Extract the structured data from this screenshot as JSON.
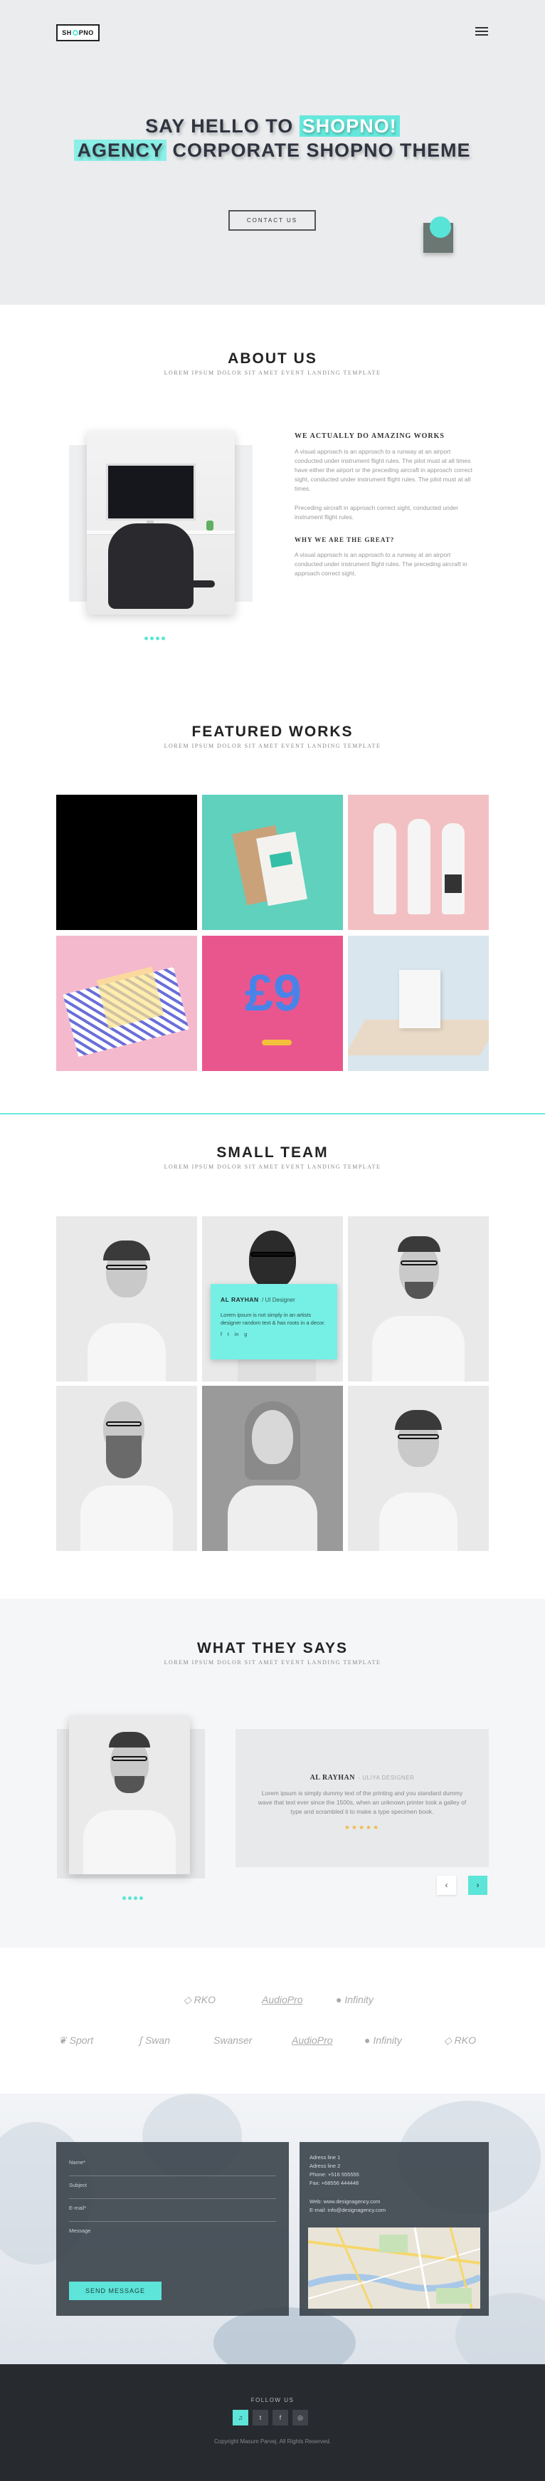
{
  "header": {
    "logo_left": "SH",
    "logo_right": "PNO",
    "menu_icon": "hamburger-icon"
  },
  "hero": {
    "line1_plain": "SAY HELLO TO",
    "line1_highlight": "SHOPNO!",
    "line2_highlight": "AGENCY",
    "line2_plain": "CORPORATE SHOPNO THEME",
    "button": "CONTACT US"
  },
  "about": {
    "title": "ABOUT US",
    "subtitle": "LOREM IPSUM DOLOR SIT AMET EVENT LANDING TEMPLATE",
    "heading1": "WE ACTUALLY DO AMAZING WORKS",
    "para1": "A visual approach is an approach to a runway at an airport conducted under instrument flight rules. The pilot must at all times have either the airport or the preceding aircraft in approach correct sight, conducted under instrument flight rules. The pilot must at all times.",
    "para2": "Preceding aircraft in approach correct sight, conducted under instrument flight rules.",
    "heading2": "WHY WE ARE THE GREAT?",
    "para3": "A visual approach is an approach to a runway at an airport conducted under instrument flight rules. The preceding aircraft in approach correct sight."
  },
  "works": {
    "title": "FEATURED WORKS",
    "subtitle": "LOREM IPSUM DOLOR SIT AMET EVENT LANDING TEMPLATE"
  },
  "team": {
    "title": "SMALL TEAM",
    "subtitle": "LOREM IPSUM DOLOR SIT AMET EVENT LANDING TEMPLATE",
    "card_name": "AL RAYHAN",
    "card_role": "/ UI Designer",
    "card_text": "Lorem ipsum is not simply in an artists designer random text & has roots in a decor.",
    "social": [
      "f",
      "t",
      "in",
      "g"
    ]
  },
  "testimonials": {
    "title": "WHAT THEY SAYS",
    "subtitle": "LOREM IPSUM DOLOR SIT AMET EVENT LANDING TEMPLATE",
    "name": "AL RAYHAN",
    "role": "- ULIYA DESIGNER",
    "quote": "Lorem ipsum is simply dummy text of the printing and you standard dummy wave that text ever since the 1500s, when an unknown printer took a galley of type and scrambled it to make a type specimen book.",
    "stars": "★★★★★",
    "prev": "‹",
    "next": "›"
  },
  "brands": {
    "row1": [
      "RKO",
      "AudioPro",
      "Infinity"
    ],
    "row2": [
      "Sport",
      "Swan",
      "Swanser",
      "AudioPro",
      "Infinity",
      "RKO"
    ]
  },
  "contact": {
    "fields": [
      "Name*",
      "Subject",
      "E-mail*",
      "Message"
    ],
    "send": "SEND MESSAGE",
    "info": [
      "Adress line 1",
      "Adress line 2",
      "Phone: +516 555555",
      "Fax: +68556 444448",
      "Web: www.designagency.com",
      "E-mail: info@designagency.com"
    ]
  },
  "footer": {
    "follow": "FOLLOW US",
    "icons": [
      "♫",
      "t",
      "f",
      "◎"
    ],
    "copyright": "Copyright Masum Parvej. All Rights Reserved."
  },
  "colors": {
    "accent": "#5ee9dd",
    "dark": "#2f3440",
    "footer": "#272a2f"
  }
}
